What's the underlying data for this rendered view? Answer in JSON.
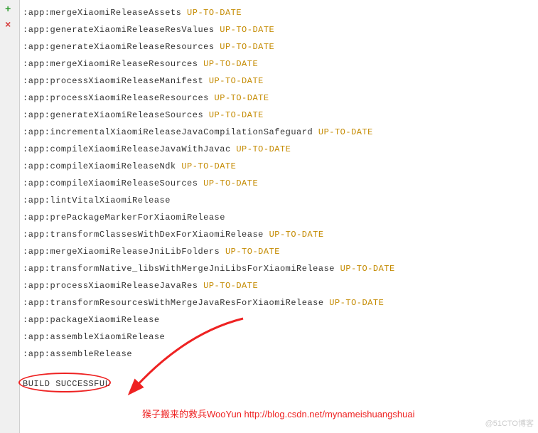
{
  "gutter": {
    "plus_icon": "+",
    "cross_icon": "×"
  },
  "lines": [
    {
      "task": ":app:mergeXiaomiReleaseAssets",
      "status": "UP-TO-DATE"
    },
    {
      "task": ":app:generateXiaomiReleaseResValues",
      "status": "UP-TO-DATE"
    },
    {
      "task": ":app:generateXiaomiReleaseResources",
      "status": "UP-TO-DATE"
    },
    {
      "task": ":app:mergeXiaomiReleaseResources",
      "status": "UP-TO-DATE"
    },
    {
      "task": ":app:processXiaomiReleaseManifest",
      "status": "UP-TO-DATE"
    },
    {
      "task": ":app:processXiaomiReleaseResources",
      "status": "UP-TO-DATE"
    },
    {
      "task": ":app:generateXiaomiReleaseSources",
      "status": "UP-TO-DATE"
    },
    {
      "task": ":app:incrementalXiaomiReleaseJavaCompilationSafeguard",
      "status": "UP-TO-DATE"
    },
    {
      "task": ":app:compileXiaomiReleaseJavaWithJavac",
      "status": "UP-TO-DATE"
    },
    {
      "task": ":app:compileXiaomiReleaseNdk",
      "status": "UP-TO-DATE"
    },
    {
      "task": ":app:compileXiaomiReleaseSources",
      "status": "UP-TO-DATE"
    },
    {
      "task": ":app:lintVitalXiaomiRelease",
      "status": ""
    },
    {
      "task": ":app:prePackageMarkerForXiaomiRelease",
      "status": ""
    },
    {
      "task": ":app:transformClassesWithDexForXiaomiRelease",
      "status": "UP-TO-DATE"
    },
    {
      "task": ":app:mergeXiaomiReleaseJniLibFolders",
      "status": "UP-TO-DATE"
    },
    {
      "task": ":app:transformNative_libsWithMergeJniLibsForXiaomiRelease",
      "status": "UP-TO-DATE"
    },
    {
      "task": ":app:processXiaomiReleaseJavaRes",
      "status": "UP-TO-DATE"
    },
    {
      "task": ":app:transformResourcesWithMergeJavaResForXiaomiRelease",
      "status": "UP-TO-DATE"
    },
    {
      "task": ":app:packageXiaomiRelease",
      "status": ""
    },
    {
      "task": ":app:assembleXiaomiRelease",
      "status": ""
    },
    {
      "task": ":app:assembleRelease",
      "status": ""
    }
  ],
  "result": "BUILD SUCCESSFUL",
  "annotation": {
    "text": "猴子搬来的救兵WooYun ",
    "url": "http://blog.csdn.net/mynameishuangshuai"
  },
  "watermark": "@51CTO博客"
}
